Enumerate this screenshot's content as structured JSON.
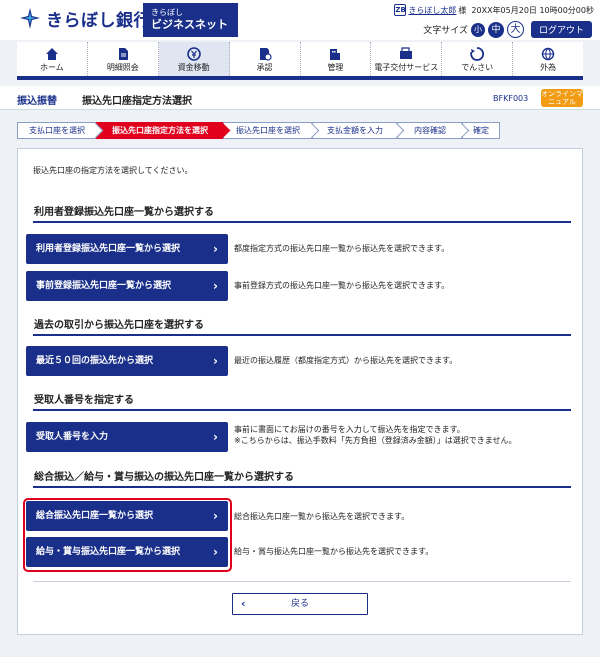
{
  "header": {
    "bank_name": "きらぼし銀行",
    "service_line1": "きらぼし",
    "service_line2": "ビジネスネット",
    "user_icon": "ZB",
    "user_name": "きらぼし太郎",
    "user_suffix": "様",
    "login_time": "20XX年05月20日 10時00分00秒",
    "font_size_label": "文字サイズ",
    "font_sizes": [
      "小",
      "中",
      "大"
    ],
    "logout_label": "ログアウト"
  },
  "nav": {
    "items": [
      {
        "label": "ホーム",
        "icon": "home-icon"
      },
      {
        "label": "明細照会",
        "icon": "document-icon"
      },
      {
        "label": "資金移動",
        "icon": "yen-transfer-icon",
        "active": true
      },
      {
        "label": "承認",
        "icon": "approval-icon"
      },
      {
        "label": "管理",
        "icon": "building-icon"
      },
      {
        "label": "電子交付サービス",
        "icon": "doc-delivery-icon"
      },
      {
        "label": "でんさい",
        "icon": "densai-icon"
      },
      {
        "label": "外為",
        "icon": "globe-icon"
      }
    ]
  },
  "page": {
    "category": "振込振替",
    "title": "振込先口座指定方法選択",
    "code": "BFKF003",
    "manual_label": "オンラインマニュアル"
  },
  "steps": [
    "支払口座を選択",
    "振込先口座指定方法を選択",
    "振込先口座を選択",
    "支払金額を入力",
    "内容確認",
    "確定"
  ],
  "content": {
    "intro": "振込先口座の指定方法を選択してください。",
    "sections": [
      {
        "title": "利用者登録振込先口座一覧から選択する"
      },
      {
        "title": "過去の取引から振込先口座を選択する"
      },
      {
        "title": "受取人番号を指定する"
      },
      {
        "title": "総合振込／給与・賞与振込の振込先口座一覧から選択する"
      }
    ],
    "buttons": {
      "user_registered": "利用者登録振込先口座一覧から選択",
      "pre_registered": "事前登録振込先口座一覧から選択",
      "recent50": "最近５０回の振込先から選択",
      "recipient_no": "受取人番号を入力",
      "general": "総合振込先口座一覧から選択",
      "salary": "給与・賞与振込先口座一覧から選択"
    },
    "descs": {
      "user_registered": "都度指定方式の振込先口座一覧から振込先を選択できます。",
      "pre_registered": "事前登録方式の振込先口座一覧から振込先を選択できます。",
      "recent50": "最近の振込履歴（都度指定方式）から振込先を選択できます。",
      "recipient_no_1": "事前に書面にてお届けの番号を入力して振込先を指定できます。",
      "recipient_no_2": "※こちらからは、振込手数料「先方負担（登録済み金額）」は選択できません。",
      "general": "総合振込先口座一覧から振込先を選択できます。",
      "salary": "給与・賞与振込先口座一覧から振込先を選択できます。"
    },
    "back_label": "戻る"
  },
  "colors": {
    "brand": "#1a2f8a",
    "active_step": "#e0001e",
    "manual": "#f29b14",
    "highlight": "#e0001e"
  }
}
